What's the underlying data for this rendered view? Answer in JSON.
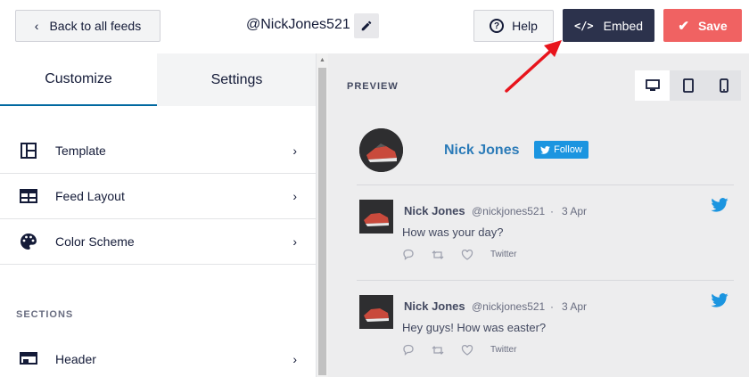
{
  "topbar": {
    "back_label": "Back to all feeds",
    "feed_name": "@NickJones521",
    "help_label": "Help",
    "embed_label": "Embed",
    "save_label": "Save"
  },
  "sidebar": {
    "tabs": [
      {
        "label": "Customize",
        "active": true
      },
      {
        "label": "Settings",
        "active": false
      }
    ],
    "items": [
      {
        "label": "Template",
        "icon": "template-icon"
      },
      {
        "label": "Feed Layout",
        "icon": "feed-layout-icon"
      },
      {
        "label": "Color Scheme",
        "icon": "palette-icon"
      }
    ],
    "section_title": "SECTIONS",
    "sections": [
      {
        "label": "Header",
        "icon": "header-icon"
      }
    ]
  },
  "preview": {
    "title": "PREVIEW",
    "devices": [
      "desktop-icon",
      "tablet-icon",
      "mobile-icon"
    ],
    "active_device": "desktop",
    "profile": {
      "name": "Nick Jones",
      "follow_label": "Follow"
    },
    "tweets": [
      {
        "name": "Nick Jones",
        "handle": "@nickjones521",
        "date": "3 Apr",
        "text": "How was your day?",
        "link_label": "Twitter"
      },
      {
        "name": "Nick Jones",
        "handle": "@nickjones521",
        "date": "3 Apr",
        "text": "Hey guys! How was easter?",
        "link_label": "Twitter"
      }
    ]
  },
  "colors": {
    "accent": "#0068a0",
    "embed": "#2c324c",
    "save": "#f06262",
    "twitter": "#1b95e0",
    "annotation_arrow": "#e8141c"
  }
}
